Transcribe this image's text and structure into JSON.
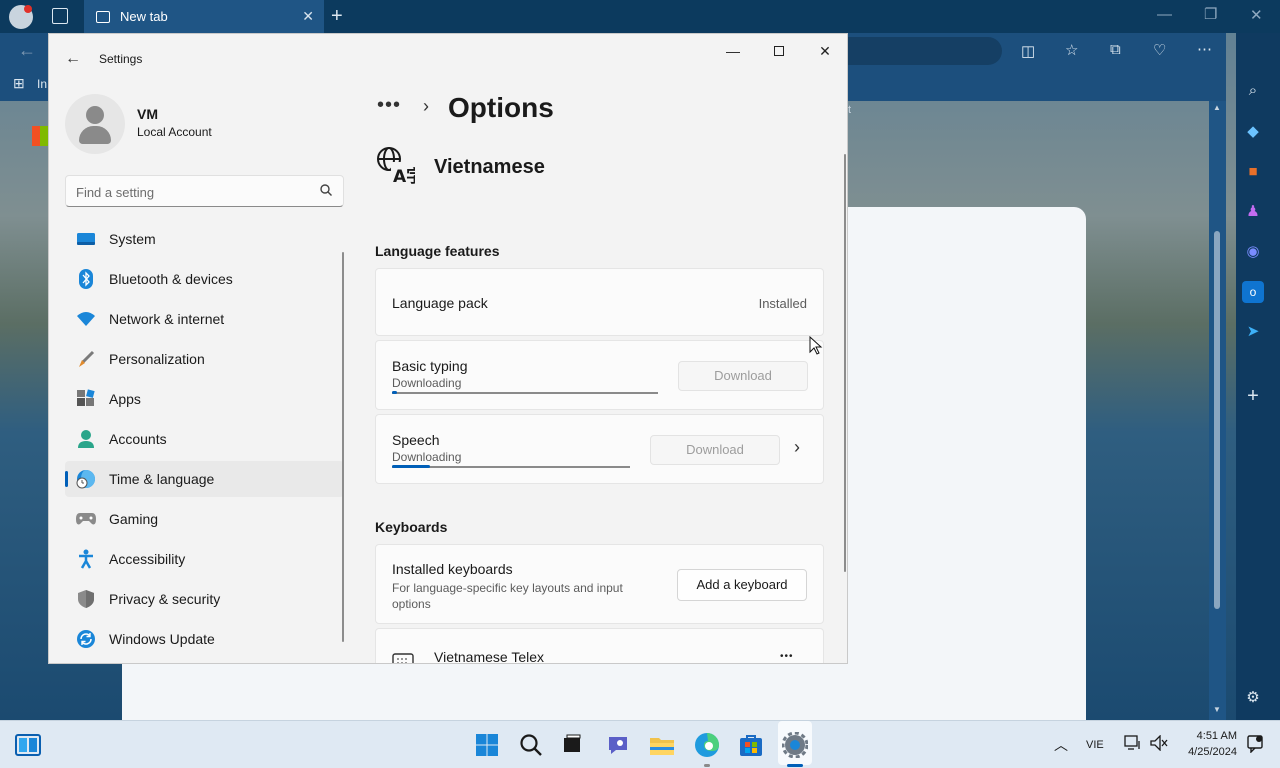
{
  "browser": {
    "tab_title": "New tab",
    "fav_fragment": "In",
    "page_fragment": "t"
  },
  "settings": {
    "app_title": "Settings",
    "user": {
      "name": "VM",
      "account_type": "Local Account"
    },
    "search_placeholder": "Find a setting",
    "nav": [
      {
        "label": "System",
        "icon": "system-icon"
      },
      {
        "label": "Bluetooth & devices",
        "icon": "bluetooth-icon"
      },
      {
        "label": "Network & internet",
        "icon": "wifi-icon"
      },
      {
        "label": "Personalization",
        "icon": "brush-icon"
      },
      {
        "label": "Apps",
        "icon": "apps-icon"
      },
      {
        "label": "Accounts",
        "icon": "accounts-icon"
      },
      {
        "label": "Time & language",
        "icon": "time-language-icon",
        "active": true
      },
      {
        "label": "Gaming",
        "icon": "gamepad-icon"
      },
      {
        "label": "Accessibility",
        "icon": "accessibility-icon"
      },
      {
        "label": "Privacy & security",
        "icon": "shield-icon"
      },
      {
        "label": "Windows Update",
        "icon": "update-icon"
      }
    ],
    "breadcrumb_dots": "•••",
    "page_title": "Options",
    "language": "Vietnamese",
    "language_features": {
      "heading": "Language features",
      "language_pack": {
        "label": "Language pack",
        "status": "Installed"
      },
      "basic_typing": {
        "label": "Basic typing",
        "status": "Downloading",
        "button": "Download",
        "progress": 0.01
      },
      "speech": {
        "label": "Speech",
        "status": "Downloading",
        "button": "Download",
        "progress": 0.16
      }
    },
    "keyboards": {
      "heading": "Keyboards",
      "installed": {
        "label": "Installed keyboards",
        "description": "For language-specific key layouts and input options",
        "button": "Add a keyboard"
      },
      "telex": {
        "label": "Vietnamese Telex",
        "more": "•••"
      }
    }
  },
  "taskbar": {
    "language": "VIE",
    "time": "4:51 AM",
    "date": "4/25/2024"
  },
  "colors": {
    "accent": "#005fb8",
    "window_bg": "#f3f3f3",
    "card_bg": "#fbfbfb"
  }
}
